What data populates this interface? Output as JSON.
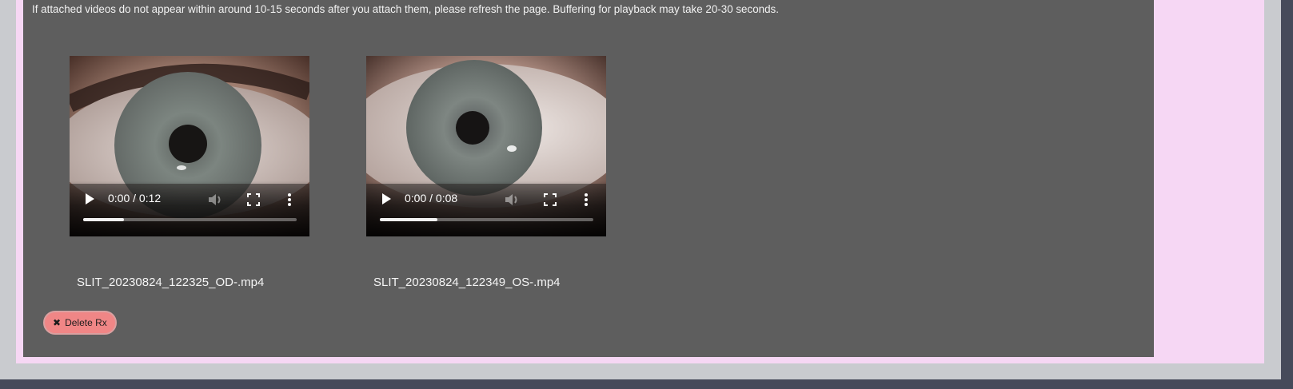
{
  "notice_text": "If attached videos do not appear within around 10-15 seconds after you attach them, please refresh the page. Buffering for playback may take 20-30 seconds.",
  "videos": [
    {
      "time": "0:00 / 0:12",
      "progress_buffered": 0.19,
      "filename": "SLIT_20230824_122325_OD-.mp4"
    },
    {
      "time": "0:00 / 0:08",
      "progress_buffered": 0.27,
      "filename": "SLIT_20230824_122349_OS-.mp4"
    }
  ],
  "delete_button": {
    "icon": "close-icon",
    "label": "Delete Rx"
  },
  "colors": {
    "page_background": "#464a5a",
    "pink_panel": "#f6d7f4",
    "content_panel": "#5e5e5e",
    "delete_button": "#f08686"
  }
}
